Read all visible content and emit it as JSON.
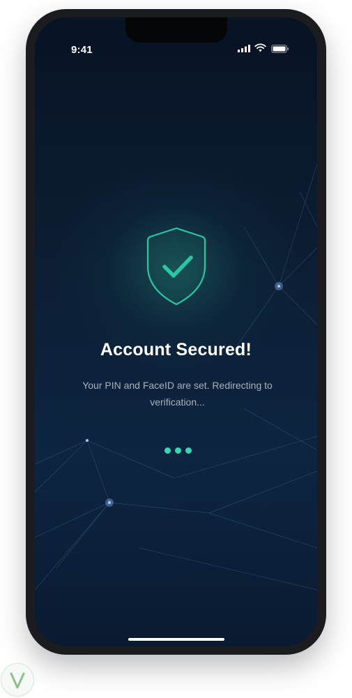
{
  "status_bar": {
    "time": "9:41",
    "icons": [
      "cellular-signal-icon",
      "wifi-icon",
      "battery-icon"
    ]
  },
  "main": {
    "icon": "shield-check-icon",
    "title": "Account Secured!",
    "message": "Your PIN and FaceID are set. Redirecting to verification...",
    "loading_indicator": "three-dot-loader"
  },
  "colors": {
    "background_top": "#081324",
    "background_bottom": "#0d2541",
    "accent": "#38d6b2",
    "shield_stroke": "#2ec4a3",
    "title": "#ffffff",
    "message": "#a9b1bd",
    "device_frame": "#1b1c1f"
  }
}
